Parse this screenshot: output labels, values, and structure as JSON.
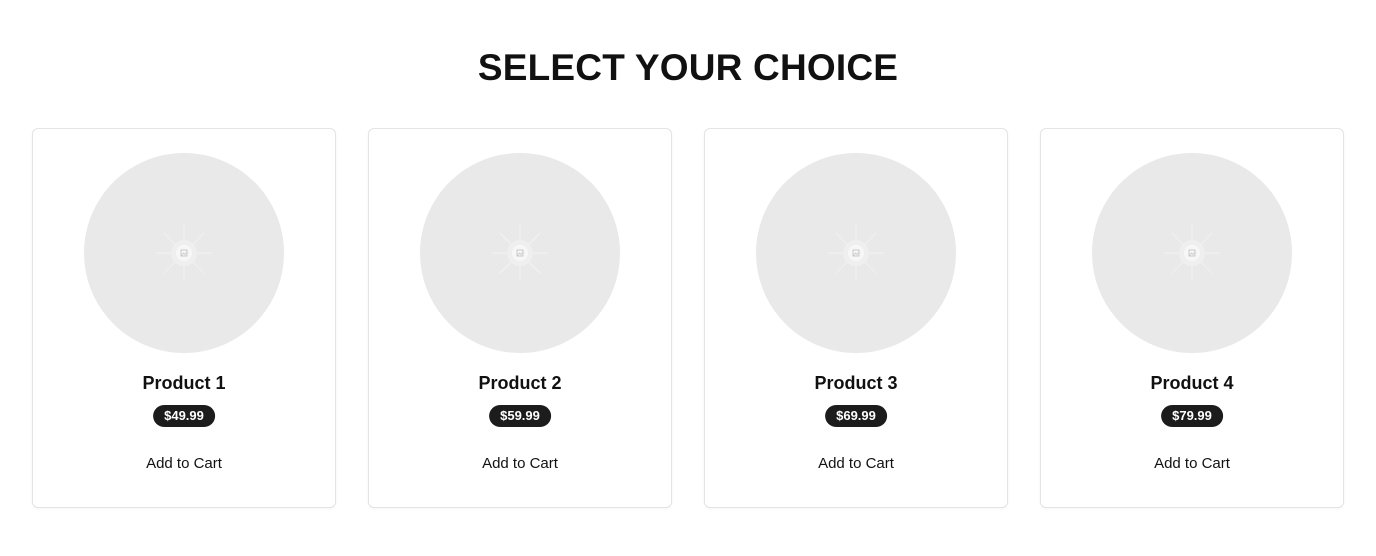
{
  "page": {
    "title": "SELECT YOUR CHOICE"
  },
  "products": [
    {
      "name": "Product 1",
      "price": "$49.99",
      "cta": "Add to Cart",
      "image_icon": "image-placeholder-icon"
    },
    {
      "name": "Product 2",
      "price": "$59.99",
      "cta": "Add to Cart",
      "image_icon": "image-placeholder-icon"
    },
    {
      "name": "Product 3",
      "price": "$69.99",
      "cta": "Add to Cart",
      "image_icon": "image-placeholder-icon"
    },
    {
      "name": "Product 4",
      "price": "$79.99",
      "cta": "Add to Cart",
      "image_icon": "image-placeholder-icon"
    }
  ],
  "colors": {
    "background": "#ffffff",
    "placeholder": "#e9e9e9",
    "price_badge": "#1c1c1c",
    "price_text": "#ffffff",
    "card_border": "#e4e4e4"
  }
}
